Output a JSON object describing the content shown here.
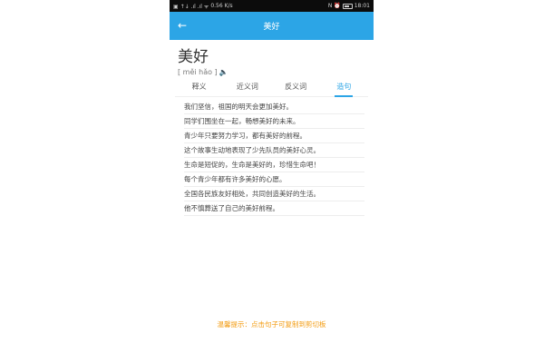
{
  "status_bar": {
    "left_icons": "▣ ↑↓ .ıl .ıl ᯤ",
    "speed": "0.56 K/s",
    "right_icons": "N ⏰",
    "battery_icon": "battery-icon",
    "time": "18:01"
  },
  "appbar": {
    "back_icon": "←",
    "title": "美好"
  },
  "word": {
    "title": "美好",
    "pinyin": "[ měi hǎo ]",
    "speaker_icon": "🔈"
  },
  "tabs": [
    {
      "label": "释义",
      "active": false
    },
    {
      "label": "近义词",
      "active": false
    },
    {
      "label": "反义词",
      "active": false
    },
    {
      "label": "造句",
      "active": true
    }
  ],
  "sentences": [
    "我们坚信，祖国的明天会更加美好。",
    "同学们围坐在一起，畅想美好的未来。",
    "青少年只要努力学习，都有美好的前程。",
    "这个故事生动地表现了少先队员的美好心灵。",
    "生命是短促的，生命是美好的，珍惜生命吧！",
    "每个青少年都有许多美好的心愿。",
    "全国各民族友好相处，共同创造美好的生活。",
    "他不慎葬送了自己的美好前程。"
  ],
  "tip": "温馨提示：点击句子可复制到剪切板",
  "colors": {
    "accent": "#2ca5e6",
    "tip": "#f39c12"
  }
}
